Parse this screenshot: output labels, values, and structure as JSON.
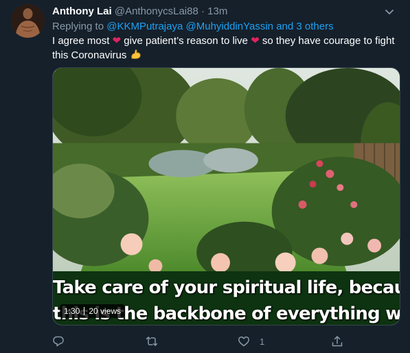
{
  "tweet": {
    "author_name": "Anthony Lai",
    "handle": "@AnthonycsLai88",
    "separator": "·",
    "time": "13m",
    "reply_prefix": "Replying to",
    "reply_user1": "@KKMPutrajaya",
    "reply_user2": "@MuhyiddinYassin",
    "reply_others": "and 3 others",
    "text_part1": "I agree most",
    "text_part2": "give patient’s reason to live",
    "text_part3": "so they have courage to fight this Coronavirus",
    "heart_emoji": "❤",
    "arm_emoji_icon": "flexed-biceps-icon"
  },
  "media": {
    "caption_line1": "Take care of your spiritual life, because",
    "caption_line2": "this is the backbone of everything we do.",
    "duration": "1:30",
    "views": "20 views"
  },
  "actions": {
    "reply_icon": "reply-icon",
    "retweet_icon": "retweet-icon",
    "like_icon": "like-icon",
    "like_count": "1",
    "share_icon": "share-icon"
  },
  "colors": {
    "background": "#15202b",
    "link": "#1da1f2",
    "muted": "#8899a6",
    "heart": "#e0245e"
  }
}
